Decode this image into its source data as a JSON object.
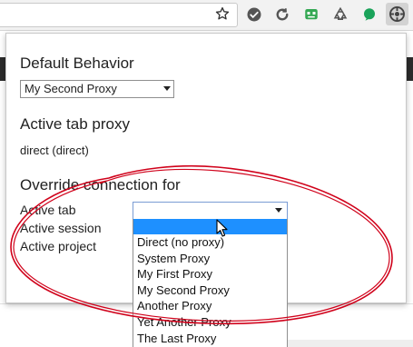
{
  "toolbar": {
    "icons": [
      "star-icon",
      "checkmark-icon",
      "refresh-icon",
      "robot-icon",
      "recycle-icon",
      "green-dot-icon",
      "proxy-gear-icon"
    ]
  },
  "popup": {
    "default_behavior": {
      "heading": "Default Behavior",
      "selected": "My Second Proxy"
    },
    "active_tab_proxy": {
      "heading": "Active tab proxy",
      "value": "direct (direct)"
    },
    "override": {
      "heading": "Override connection for",
      "rows": {
        "tab": "Active tab",
        "session": "Active session",
        "project": "Active project"
      },
      "selected": ""
    }
  },
  "dropdown": {
    "options": [
      "",
      "Direct (no proxy)",
      "System Proxy",
      "My First Proxy",
      "My Second Proxy",
      "Another Proxy",
      "Yet Another Proxy",
      "The Last Proxy"
    ],
    "highlighted_index": 0
  },
  "colors": {
    "highlight": "#1e90ff",
    "annotation": "#d0021b",
    "active_ext_bg": "#d3d3d3"
  }
}
